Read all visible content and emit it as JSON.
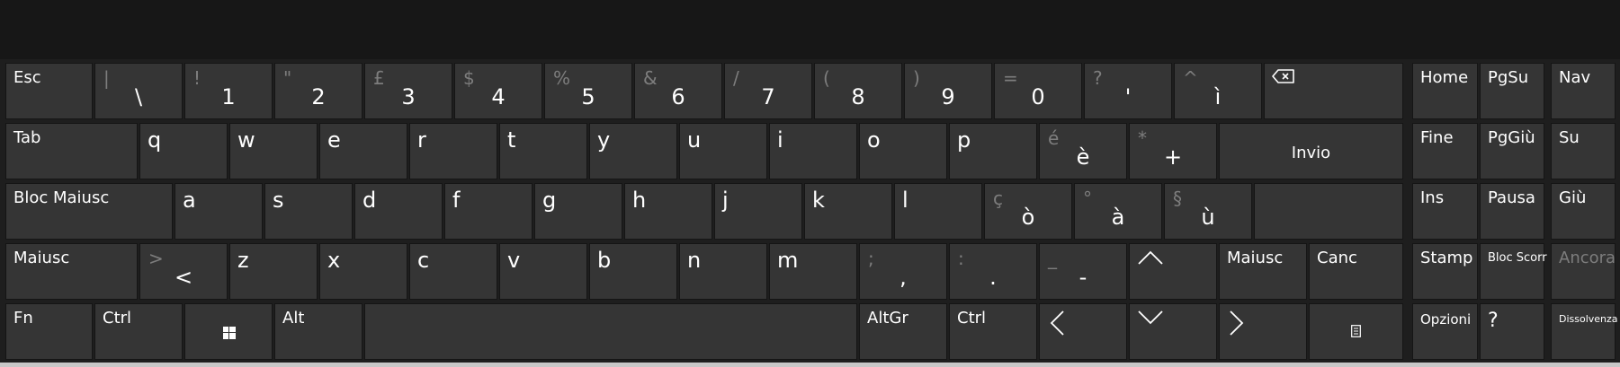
{
  "keys": {
    "esc": "Esc",
    "backslash": {
      "shift": "|",
      "main": "\\"
    },
    "1": {
      "shift": "!",
      "main": "1"
    },
    "2": {
      "shift": "\"",
      "main": "2"
    },
    "3": {
      "shift": "£",
      "main": "3"
    },
    "4": {
      "shift": "$",
      "main": "4"
    },
    "5": {
      "shift": "%",
      "main": "5"
    },
    "6": {
      "shift": "&",
      "main": "6"
    },
    "7": {
      "shift": "/",
      "main": "7"
    },
    "8": {
      "shift": "(",
      "main": "8"
    },
    "9": {
      "shift": ")",
      "main": "9"
    },
    "0": {
      "shift": "=",
      "main": "0"
    },
    "apostrophe": {
      "shift": "?",
      "main": "'"
    },
    "igrave": {
      "shift": "^",
      "main": "ì"
    },
    "tab": "Tab",
    "q": "q",
    "w": "w",
    "e": "e",
    "r": "r",
    "t": "t",
    "y": "y",
    "u": "u",
    "i": "i",
    "o": "o",
    "p": "p",
    "egrave": {
      "shift": "é",
      "main": "è"
    },
    "plus": {
      "shift": "*",
      "main": "+"
    },
    "enter": "Invio",
    "capslock": "Bloc Maiusc",
    "a": "a",
    "s": "s",
    "d": "d",
    "f": "f",
    "g": "g",
    "h": "h",
    "j": "j",
    "k": "k",
    "l": "l",
    "ograve": {
      "shift": "ç",
      "main": "ò"
    },
    "agrave": {
      "shift": "°",
      "main": "à"
    },
    "ugrave": {
      "shift": "§",
      "main": "ù"
    },
    "shift_left": "Maiusc",
    "lessthan": {
      "shift": ">",
      "main": "<"
    },
    "z": "z",
    "x": "x",
    "c": "c",
    "v": "v",
    "b": "b",
    "n": "n",
    "m": "m",
    "comma": {
      "shift": ";",
      "main": ","
    },
    "period": {
      "shift": ":",
      "main": "."
    },
    "minus": {
      "shift": "_",
      "main": "-"
    },
    "shift_right": "Maiusc",
    "canc": "Canc",
    "fn": "Fn",
    "ctrl_left": "Ctrl",
    "alt": "Alt",
    "altgr": "AltGr",
    "ctrl_right": "Ctrl"
  },
  "side_keys": {
    "home": "Home",
    "pgup": "PgSu",
    "nav": "Nav",
    "end": "Fine",
    "pgdn": "PgGiù",
    "up": "Su",
    "ins": "Ins",
    "pause": "Pausa",
    "down": "Giù",
    "print": "Stamp",
    "scrolllock": "Bloc Scorr",
    "dock": "Ancora",
    "options": "Opzioni",
    "help": "?",
    "fade": "Dissolvenza"
  },
  "icons": [
    "backspace-icon",
    "windows-icon",
    "arrow-up-icon",
    "arrow-left-icon",
    "arrow-down-icon",
    "arrow-right-icon",
    "context-menu-icon"
  ],
  "colors": {
    "key_bg": "#353535",
    "board_bg": "#1e1e1e",
    "shift_char": "#7d7d7d",
    "text": "#ffffff"
  }
}
